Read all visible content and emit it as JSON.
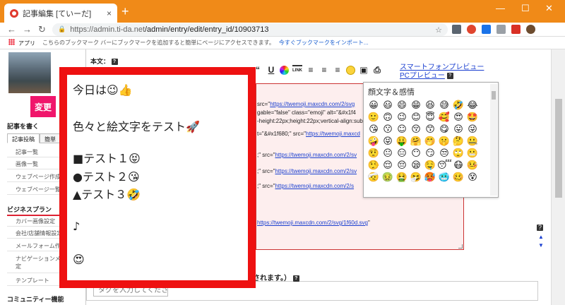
{
  "browser": {
    "tab_title": "記事編集 [ていーだ]",
    "close_glyph": "×",
    "new_tab_glyph": "+",
    "window_controls": [
      "—",
      "☐",
      "✕"
    ],
    "nav": {
      "back": "←",
      "forward": "→",
      "reload": "↻"
    },
    "url_host": "https://admin.ti-da.net",
    "url_path": "/admin/entry/edit/entry_id/10903713",
    "star_glyph": "☆",
    "lock_glyph": "🔒"
  },
  "bookmarks": {
    "apps_label": "アプリ",
    "hint_text": "こちらのブックマーク バーにブックマークを追加すると簡単にページにアクセスできます。",
    "import_link": "今すぐブックマークをインポート..."
  },
  "sidebar": {
    "change_button": "変更",
    "write_heading": "記事を書く",
    "tabs": [
      "記事投稿",
      "簡単"
    ],
    "items_top": [
      "記事一覧",
      "画像一覧",
      "ウェブページ作成",
      "ウェブページ一覧"
    ],
    "business_heading": "ビジネスプラン",
    "items_business": [
      "カバー画像設定",
      "会社/店舗情報設定",
      "メールフォーム作成",
      "ナビゲーションメニュー設定",
      "テンプレート"
    ],
    "community_heading": "コミュニティー機能"
  },
  "editor": {
    "body_label": "本文",
    "required_mark": "：",
    "help_glyph": "?",
    "toolbar": [
      "“",
      "U",
      "LINK"
    ],
    "preview_smartphone": "スマートフォンプレビュー",
    "preview_pc": "PCプレビュー",
    "code_lines": [
      {
        "pre": "src=\"",
        "url": "https://twemoji.maxcdn.com/2/svg",
        "post": ""
      },
      {
        "pre": "gable=\"false\" class=\"emoji\" alt=\"&#x1f4",
        "url": "",
        "post": ""
      },
      {
        "pre": "-height:22px;height:22px;vertical-align:sub;\"",
        "url": "",
        "post": ""
      },
      {
        "pre": "t=\"&#x1f680;\" src=\"",
        "url": "https://twemoji.maxcd",
        "post": ""
      },
      {
        "pre": ";\" src=\"",
        "url": "https://twemoji.maxcdn.com/2/sv",
        "post": ""
      },
      {
        "pre": ";\" src=\"",
        "url": "https://twemoji.maxcdn.com/2/sv",
        "post": ""
      },
      {
        "pre": ";\" src=\"",
        "url": "https://twemoji.maxcdn.com/2/s",
        "post": ""
      },
      {
        "pre": "",
        "url": "https://twemoji.maxcdn.com/2/svg/1f60d.svg",
        "post": "\""
      }
    ]
  },
  "emoji_picker": {
    "title": "顔文字＆感情",
    "emojis": [
      "😀",
      "😃",
      "😄",
      "😁",
      "😆",
      "😅",
      "🤣",
      "😂",
      "🙂",
      "🙃",
      "😉",
      "😊",
      "😇",
      "🥰",
      "😍",
      "🤩",
      "😘",
      "😗",
      "☺",
      "😚",
      "😙",
      "😋",
      "😛",
      "😜",
      "🤪",
      "😝",
      "🤑",
      "🤗",
      "🤭",
      "🤫",
      "🤔",
      "🤐",
      "🤨",
      "😐",
      "😑",
      "😶",
      "😏",
      "😒",
      "🙄",
      "😬",
      "🤥",
      "😌",
      "😔",
      "😪",
      "🤤",
      "😴",
      "😷",
      "🤒",
      "🤕",
      "🤢",
      "🤮",
      "🤧",
      "🥵",
      "🥶",
      "🥴",
      "😵"
    ]
  },
  "tags": {
    "confirm_text": "確定されます。）",
    "placeholder": "タグを入力してください"
  },
  "overlay": {
    "lines": [
      "今日は😉👍",
      "色々と絵文字をテスト🚀",
      "■テスト１😝",
      "●テスト２😘",
      "▲テスト３🤣",
      "♪",
      "😍"
    ]
  }
}
